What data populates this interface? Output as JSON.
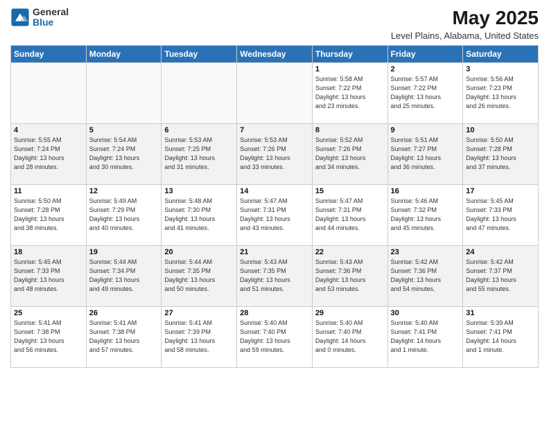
{
  "header": {
    "logo": {
      "general": "General",
      "blue": "Blue"
    },
    "title": "May 2025",
    "location": "Level Plains, Alabama, United States"
  },
  "weekdays": [
    "Sunday",
    "Monday",
    "Tuesday",
    "Wednesday",
    "Thursday",
    "Friday",
    "Saturday"
  ],
  "weeks": [
    [
      {
        "day": "",
        "empty": true
      },
      {
        "day": "",
        "empty": true
      },
      {
        "day": "",
        "empty": true
      },
      {
        "day": "",
        "empty": true
      },
      {
        "day": "1",
        "info": "Sunrise: 5:58 AM\nSunset: 7:22 PM\nDaylight: 13 hours\nand 23 minutes."
      },
      {
        "day": "2",
        "info": "Sunrise: 5:57 AM\nSunset: 7:22 PM\nDaylight: 13 hours\nand 25 minutes."
      },
      {
        "day": "3",
        "info": "Sunrise: 5:56 AM\nSunset: 7:23 PM\nDaylight: 13 hours\nand 26 minutes."
      }
    ],
    [
      {
        "day": "4",
        "info": "Sunrise: 5:55 AM\nSunset: 7:24 PM\nDaylight: 13 hours\nand 28 minutes."
      },
      {
        "day": "5",
        "info": "Sunrise: 5:54 AM\nSunset: 7:24 PM\nDaylight: 13 hours\nand 30 minutes."
      },
      {
        "day": "6",
        "info": "Sunrise: 5:53 AM\nSunset: 7:25 PM\nDaylight: 13 hours\nand 31 minutes."
      },
      {
        "day": "7",
        "info": "Sunrise: 5:53 AM\nSunset: 7:26 PM\nDaylight: 13 hours\nand 33 minutes."
      },
      {
        "day": "8",
        "info": "Sunrise: 5:52 AM\nSunset: 7:26 PM\nDaylight: 13 hours\nand 34 minutes."
      },
      {
        "day": "9",
        "info": "Sunrise: 5:51 AM\nSunset: 7:27 PM\nDaylight: 13 hours\nand 36 minutes."
      },
      {
        "day": "10",
        "info": "Sunrise: 5:50 AM\nSunset: 7:28 PM\nDaylight: 13 hours\nand 37 minutes."
      }
    ],
    [
      {
        "day": "11",
        "info": "Sunrise: 5:50 AM\nSunset: 7:28 PM\nDaylight: 13 hours\nand 38 minutes."
      },
      {
        "day": "12",
        "info": "Sunrise: 5:49 AM\nSunset: 7:29 PM\nDaylight: 13 hours\nand 40 minutes."
      },
      {
        "day": "13",
        "info": "Sunrise: 5:48 AM\nSunset: 7:30 PM\nDaylight: 13 hours\nand 41 minutes."
      },
      {
        "day": "14",
        "info": "Sunrise: 5:47 AM\nSunset: 7:31 PM\nDaylight: 13 hours\nand 43 minutes."
      },
      {
        "day": "15",
        "info": "Sunrise: 5:47 AM\nSunset: 7:31 PM\nDaylight: 13 hours\nand 44 minutes."
      },
      {
        "day": "16",
        "info": "Sunrise: 5:46 AM\nSunset: 7:32 PM\nDaylight: 13 hours\nand 45 minutes."
      },
      {
        "day": "17",
        "info": "Sunrise: 5:45 AM\nSunset: 7:33 PM\nDaylight: 13 hours\nand 47 minutes."
      }
    ],
    [
      {
        "day": "18",
        "info": "Sunrise: 5:45 AM\nSunset: 7:33 PM\nDaylight: 13 hours\nand 48 minutes."
      },
      {
        "day": "19",
        "info": "Sunrise: 5:44 AM\nSunset: 7:34 PM\nDaylight: 13 hours\nand 49 minutes."
      },
      {
        "day": "20",
        "info": "Sunrise: 5:44 AM\nSunset: 7:35 PM\nDaylight: 13 hours\nand 50 minutes."
      },
      {
        "day": "21",
        "info": "Sunrise: 5:43 AM\nSunset: 7:35 PM\nDaylight: 13 hours\nand 51 minutes."
      },
      {
        "day": "22",
        "info": "Sunrise: 5:43 AM\nSunset: 7:36 PM\nDaylight: 13 hours\nand 53 minutes."
      },
      {
        "day": "23",
        "info": "Sunrise: 5:42 AM\nSunset: 7:36 PM\nDaylight: 13 hours\nand 54 minutes."
      },
      {
        "day": "24",
        "info": "Sunrise: 5:42 AM\nSunset: 7:37 PM\nDaylight: 13 hours\nand 55 minutes."
      }
    ],
    [
      {
        "day": "25",
        "info": "Sunrise: 5:41 AM\nSunset: 7:38 PM\nDaylight: 13 hours\nand 56 minutes."
      },
      {
        "day": "26",
        "info": "Sunrise: 5:41 AM\nSunset: 7:38 PM\nDaylight: 13 hours\nand 57 minutes."
      },
      {
        "day": "27",
        "info": "Sunrise: 5:41 AM\nSunset: 7:39 PM\nDaylight: 13 hours\nand 58 minutes."
      },
      {
        "day": "28",
        "info": "Sunrise: 5:40 AM\nSunset: 7:40 PM\nDaylight: 13 hours\nand 59 minutes."
      },
      {
        "day": "29",
        "info": "Sunrise: 5:40 AM\nSunset: 7:40 PM\nDaylight: 14 hours\nand 0 minutes."
      },
      {
        "day": "30",
        "info": "Sunrise: 5:40 AM\nSunset: 7:41 PM\nDaylight: 14 hours\nand 1 minute."
      },
      {
        "day": "31",
        "info": "Sunrise: 5:39 AM\nSunset: 7:41 PM\nDaylight: 14 hours\nand 1 minute."
      }
    ]
  ]
}
